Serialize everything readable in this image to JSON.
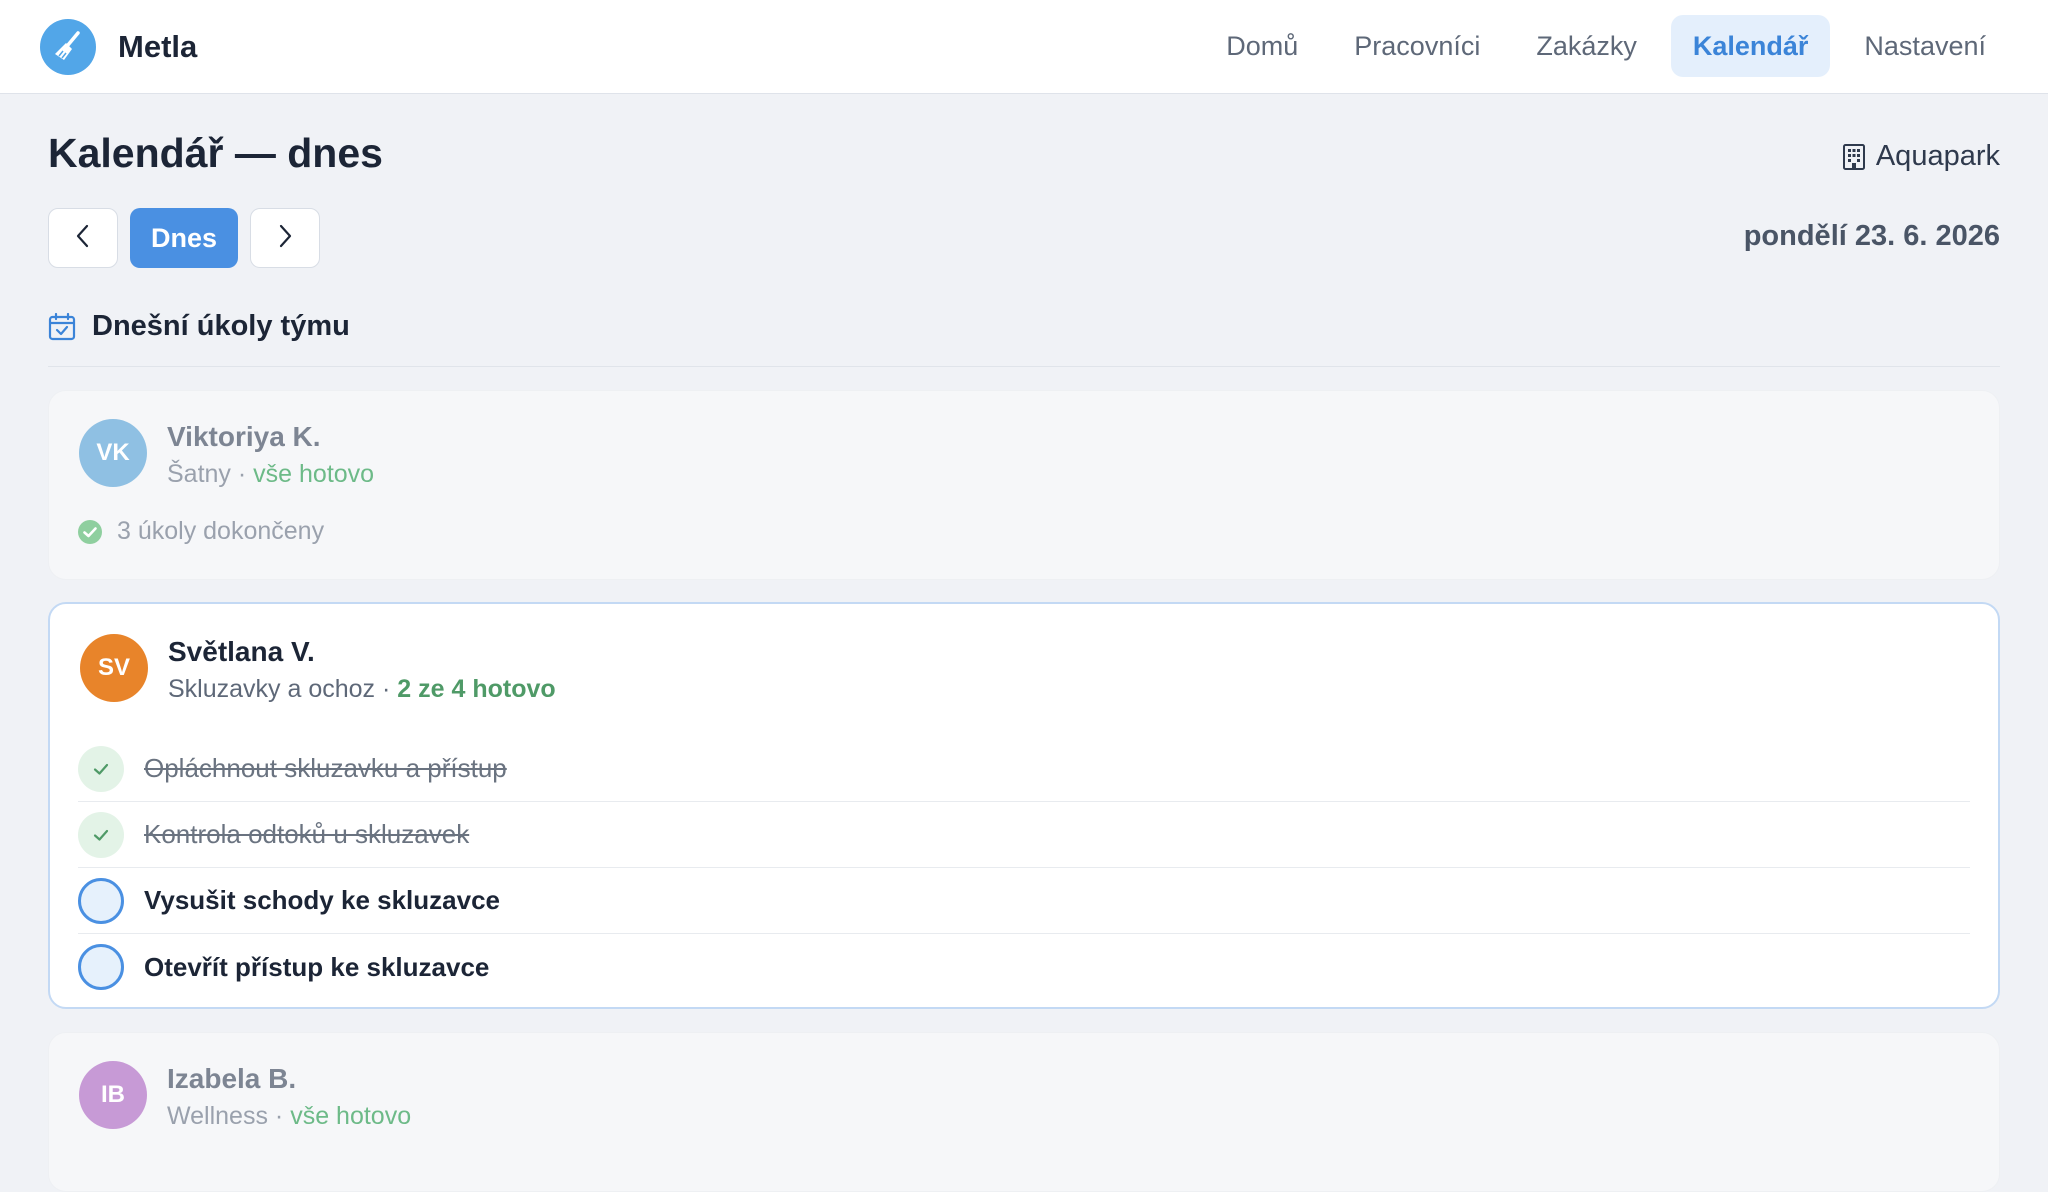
{
  "app": {
    "name": "Metla",
    "logo_icon": "broom-icon",
    "logo_color": "#52a6e8"
  },
  "nav": {
    "items": [
      {
        "label": "Domů",
        "active": false
      },
      {
        "label": "Pracovníci",
        "active": false
      },
      {
        "label": "Zakázky",
        "active": false
      },
      {
        "label": "Kalendář",
        "active": true
      },
      {
        "label": "Nastavení",
        "active": false
      }
    ]
  },
  "page": {
    "title": "Kalendář — dnes",
    "location": "Aquapark",
    "location_icon": "building-icon",
    "today_label": "Dnes",
    "prev_icon": "chevron-left-icon",
    "next_icon": "chevron-right-icon",
    "date": "pondělí 23. 6. 2026"
  },
  "section": {
    "title": "Dnešní úkoly týmu",
    "icon": "calendar-check-icon"
  },
  "workers": [
    {
      "initials": "VK",
      "name": "Viktoriya K.",
      "area": "Šatny",
      "status": "vše hotovo",
      "avatar_color": "#8fc0e3",
      "summary": "3 úkoly dokončeny"
    },
    {
      "initials": "SV",
      "name": "Světlana V.",
      "area": "Skluzavky a ochoz",
      "status": "2 ze 4 hotovo",
      "avatar_color": "#e8842a",
      "tasks": [
        {
          "label": "Opláchnout skluzavku a přístup",
          "done": true
        },
        {
          "label": "Kontrola odtoků u skluzavek",
          "done": true
        },
        {
          "label": "Vysušit schody ke skluzavce",
          "done": false
        },
        {
          "label": "Otevřít přístup ke skluzavce",
          "done": false
        }
      ]
    },
    {
      "initials": "IB",
      "name": "Izabela B.",
      "area": "Wellness",
      "status": "vše hotovo",
      "avatar_color": "#c79ad6"
    }
  ],
  "separator": "·",
  "colors": {
    "accent": "#4a90e2",
    "success": "#4f9a67",
    "background": "#f0f2f6"
  }
}
